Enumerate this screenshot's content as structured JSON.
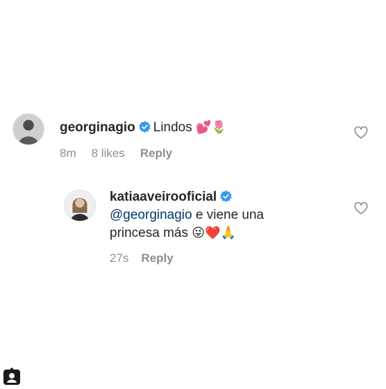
{
  "comments": [
    {
      "username": "georginagio",
      "verified": true,
      "text": "Lindos",
      "emojis": "💕🌷",
      "time": "8m",
      "likes": "8 likes",
      "reply_label": "Reply"
    },
    {
      "username": "katiaaveirooficial",
      "verified": true,
      "mention": "@georginagio",
      "text_line1": "e viene una",
      "text_line2": "princesa más",
      "emojis": "😜❤️🙏",
      "time": "27s",
      "reply_label": "Reply"
    }
  ],
  "colors": {
    "text": "#262626",
    "muted": "#8e8e8e",
    "verified": "#3897f0",
    "mention": "#00376b"
  }
}
